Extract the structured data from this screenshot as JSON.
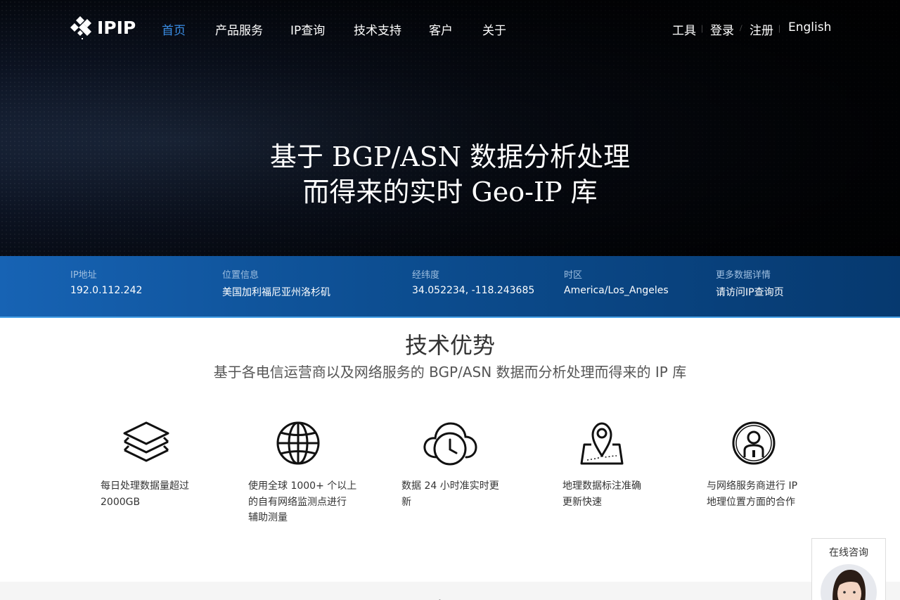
{
  "nav": {
    "logo_text": "IPIP",
    "items": [
      {
        "label": "首页",
        "active": true
      },
      {
        "label": "产品服务"
      },
      {
        "label": "IP查询"
      },
      {
        "label": "技术支持"
      },
      {
        "label": "客户"
      },
      {
        "label": "关于"
      }
    ],
    "right": {
      "tools": "工具",
      "login": "登录",
      "register": "注册",
      "language": "English"
    }
  },
  "hero": {
    "line1": "基于 BGP/ASN 数据分析处理",
    "line2": "而得来的实时 Geo-IP 库"
  },
  "ip_info": [
    {
      "label": "IP地址",
      "value": "192.0.112.242"
    },
    {
      "label": "位置信息",
      "value": "美国加利福尼亚州洛杉矶"
    },
    {
      "label": "经纬度",
      "value": "34.052234, -118.243685"
    },
    {
      "label": "时区",
      "value": "America/Los_Angeles"
    },
    {
      "label": "更多数据详情",
      "value": "请访问IP查询页"
    }
  ],
  "advantages": {
    "title": "技术优势",
    "subtitle": "基于各电信运营商以及网络服务的 BGP/ASN 数据而分析处理而得来的 IP 库",
    "items": [
      {
        "icon": "layers-icon",
        "lines": [
          "每日处理数据量超过",
          "2000GB"
        ]
      },
      {
        "icon": "globe-icon",
        "lines": [
          "使用全球 1000+ 个以上",
          "的自有网络监测点进行",
          "辅助测量"
        ]
      },
      {
        "icon": "cloud-clock-icon",
        "lines": [
          "数据 24 小时准实时更",
          "新"
        ]
      },
      {
        "icon": "map-pin-icon",
        "lines": [
          "地理数据标注准确",
          "更新快速"
        ]
      },
      {
        "icon": "user-id-icon",
        "lines": [
          "与网络服务商进行 IP",
          "地理位置方面的合作"
        ]
      }
    ]
  },
  "next_section": {
    "title": "产品"
  },
  "chat_widget": {
    "label": "在线咨询"
  },
  "colors": {
    "accent": "#3a8ee6",
    "infobar": "#0d4f93"
  }
}
